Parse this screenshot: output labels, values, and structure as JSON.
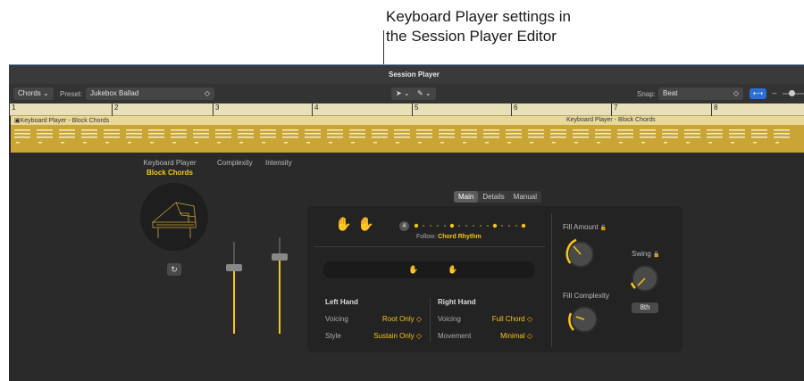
{
  "callout": {
    "line1": "Keyboard Player settings in",
    "line2": "the Session Player Editor"
  },
  "window": {
    "title": "Session Player"
  },
  "toolbar": {
    "track_type": "Chords",
    "preset_label": "Preset:",
    "preset_value": "Jukebox Ballad",
    "snap_label": "Snap:",
    "snap_value": "Beat",
    "pointer_tool": "pointer-tool",
    "pencil_tool": "pencil-tool"
  },
  "ruler": {
    "bars": [
      "1",
      "2",
      "3",
      "4",
      "5",
      "6",
      "7",
      "8"
    ]
  },
  "regions": [
    {
      "label": "Keyboard Player - Block Chords"
    },
    {
      "label": "Keyboard Player - Block Chords"
    }
  ],
  "editor_tabs": [
    {
      "label": "Main",
      "active": true
    },
    {
      "label": "Details",
      "active": false
    },
    {
      "label": "Manual",
      "active": false
    }
  ],
  "player": {
    "name": "Keyboard Player",
    "style": "Block Chords"
  },
  "sliders": {
    "complexity": {
      "label": "Complexity",
      "level": 0.72
    },
    "intensity": {
      "label": "Intensity",
      "level": 0.8
    }
  },
  "follow": {
    "count": "4",
    "label": "Follow:",
    "value": "Chord Rhythm"
  },
  "left_hand": {
    "title": "Left Hand",
    "voicing_label": "Voicing",
    "voicing_value": "Root Only ◇",
    "style_label": "Style",
    "style_value": "Sustain Only ◇"
  },
  "right_hand": {
    "title": "Right Hand",
    "voicing_label": "Voicing",
    "voicing_value": "Full Chord ◇",
    "movement_label": "Movement",
    "movement_value": "Minimal ◇"
  },
  "knobs": {
    "fill_amount": {
      "label": "Fill Amount"
    },
    "fill_complexity": {
      "label": "Fill Complexity"
    },
    "swing": {
      "label": "Swing",
      "value": "8th"
    }
  },
  "colors": {
    "accent": "#f5c518",
    "region": "#c8a534",
    "background": "#2a2a2a",
    "button_blue": "#2a6fd6"
  }
}
